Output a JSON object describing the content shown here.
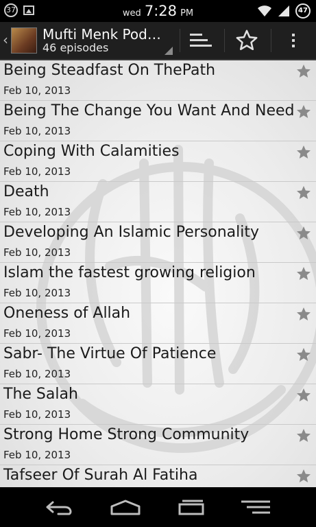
{
  "status_bar": {
    "notification_count": "37",
    "day": "wed",
    "time": "7:28",
    "ampm": "PM",
    "battery": "47"
  },
  "action_bar": {
    "title": "Mufti Menk Pod…",
    "subtitle": "46 episodes"
  },
  "episodes": [
    {
      "title": "Being Steadfast On ThePath",
      "date": "Feb 10, 2013"
    },
    {
      "title": "Being The Change You Want And Need",
      "date": "Feb 10, 2013"
    },
    {
      "title": "Coping With Calamities",
      "date": "Feb 10, 2013"
    },
    {
      "title": "Death",
      "date": "Feb 10, 2013"
    },
    {
      "title": "Developing An Islamic Personality",
      "date": "Feb 10, 2013"
    },
    {
      "title": "Islam the fastest growing religion",
      "date": "Feb 10, 2013"
    },
    {
      "title": "Oneness of Allah",
      "date": "Feb 10, 2013"
    },
    {
      "title": "Sabr- The Virtue Of Patience",
      "date": "Feb 10, 2013"
    },
    {
      "title": "The Salah",
      "date": "Feb 10, 2013"
    },
    {
      "title": "Strong Home Strong Community",
      "date": "Feb 10, 2013"
    },
    {
      "title": "Tafseer Of Surah Al Fatiha",
      "date": ""
    }
  ],
  "icons": {
    "up": "chevron-left-icon",
    "sort": "sort-icon",
    "favorites": "star-icon",
    "overflow": "overflow-menu-icon",
    "back": "back-icon",
    "home": "home-icon",
    "recents": "recents-icon",
    "menu": "menu-icon"
  },
  "colors": {
    "action_bar_bg": "#1f1f1f",
    "star_gray": "#8a8a8a",
    "list_bg": "#ececec"
  }
}
